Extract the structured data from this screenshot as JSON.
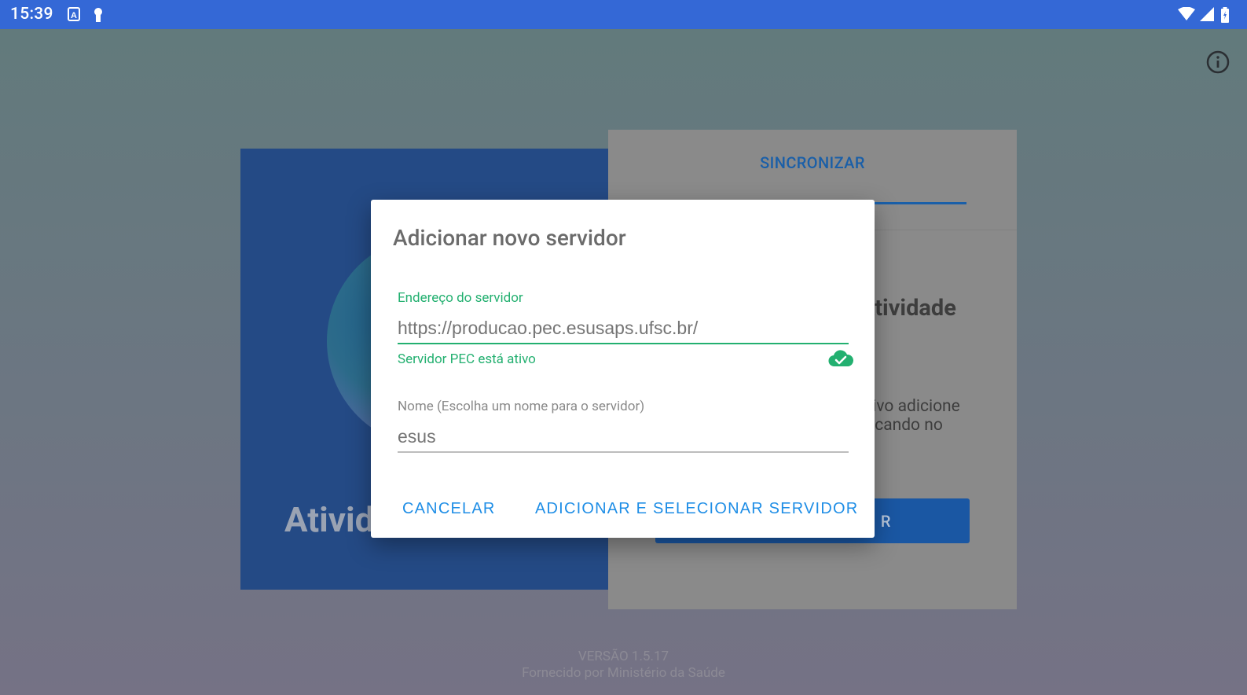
{
  "status_bar": {
    "time": "15:39"
  },
  "background_card": {
    "left_title": "Ativid",
    "tab_label": "SINCRONIZAR",
    "heading": "Atividade",
    "text_line_1": "ativo adicione",
    "text_line_2": "clicando no",
    "button_label": "R"
  },
  "footer": {
    "version": "VERSÃO 1.5.17",
    "provider": "Fornecido por Ministério da Saúde"
  },
  "dialog": {
    "title": "Adicionar novo servidor",
    "address_label": "Endereço do servidor",
    "address_placeholder": "https://producao.pec.esusaps.ufsc.br/",
    "address_helper": "Servidor PEC está ativo",
    "name_label": "Nome (Escolha um nome para o servidor)",
    "name_placeholder": "esus",
    "cancel_label": "CANCELAR",
    "confirm_label": "ADICIONAR E SELECIONAR SERVIDOR"
  },
  "colors": {
    "status_bar": "#3468d6",
    "success": "#23b070",
    "action": "#1f8ee6",
    "primary_dark": "#244a85"
  }
}
